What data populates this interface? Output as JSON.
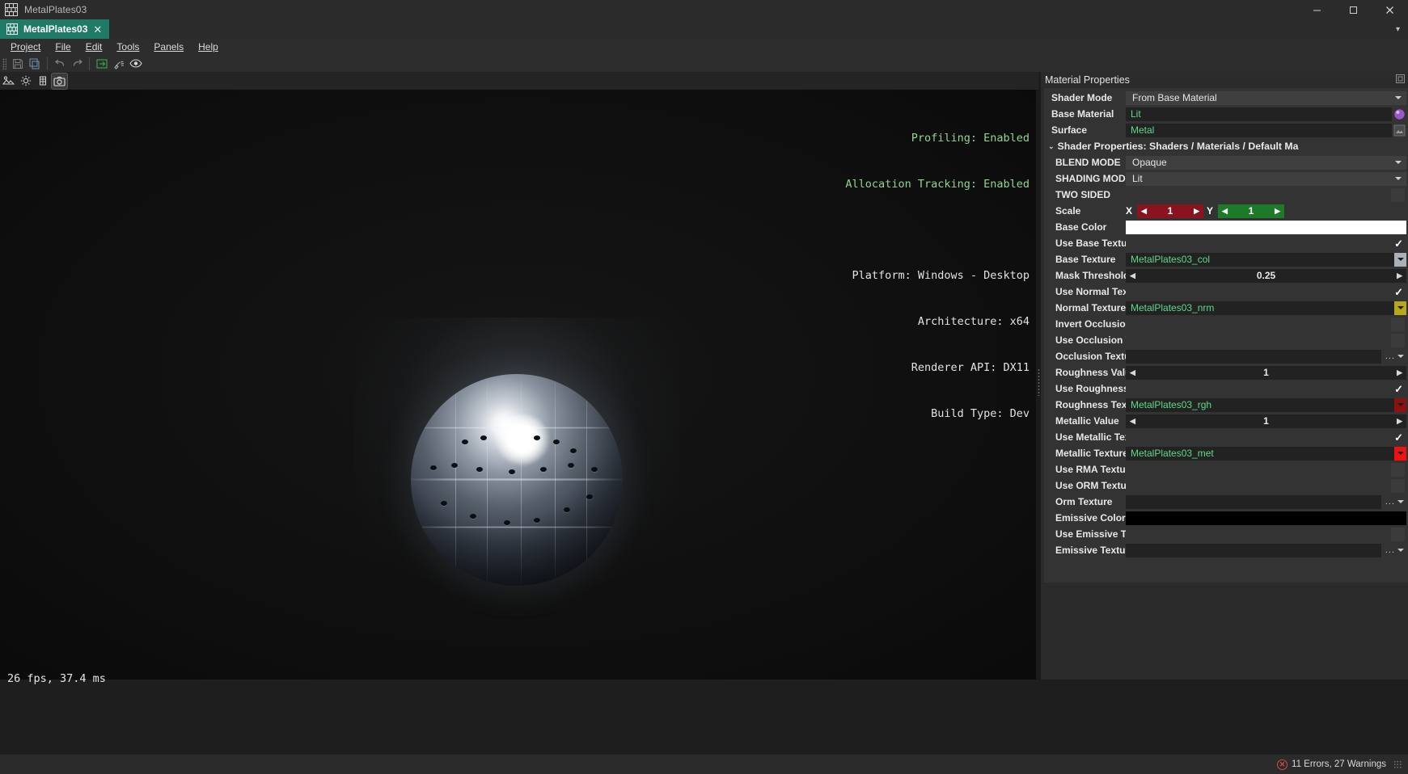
{
  "window": {
    "title": "MetalPlates03",
    "app_icon": "brick-wall-icon",
    "minimize": "—",
    "maximize": "□",
    "close": "✕"
  },
  "tabs": {
    "items": [
      {
        "label": "MetalPlates03",
        "icon": "brick-wall-icon",
        "close": "✕",
        "active": true
      }
    ],
    "overflow_chevron": "▾"
  },
  "menubar": {
    "items": [
      {
        "label": "Project"
      },
      {
        "label": "File"
      },
      {
        "label": "Edit"
      },
      {
        "label": "Tools"
      },
      {
        "label": "Panels"
      },
      {
        "label": "Help"
      }
    ]
  },
  "toolbar": {
    "buttons": [
      {
        "name": "save-icon"
      },
      {
        "name": "save-all-icon"
      },
      {
        "name": "undo-icon"
      },
      {
        "name": "redo-icon"
      },
      {
        "name": "export-icon"
      },
      {
        "name": "clean-icon"
      },
      {
        "name": "preview-eye-icon"
      }
    ]
  },
  "view_toolbar": {
    "buttons": [
      {
        "name": "asset-preview-icon"
      },
      {
        "name": "lighting-icon"
      },
      {
        "name": "grid-icon"
      },
      {
        "name": "camera-icon",
        "active": true
      }
    ]
  },
  "viewport": {
    "overlay": {
      "line1": "Profiling: Enabled",
      "line2": "Allocation Tracking: Enabled",
      "line3": "Platform: Windows - Desktop",
      "line4": "Architecture: x64",
      "line5": "Renderer API: DX11",
      "line6": "Build Type: Dev"
    },
    "fps": "26 fps, 37.4 ms",
    "preview_object": "metal-plates-sphere"
  },
  "properties": {
    "panel_title": "Material Properties",
    "dock_icon": "dock-panel-icon",
    "rows": [
      {
        "label": "Shader Mode",
        "type": "dropdown",
        "value": "From Base Material"
      },
      {
        "label": "Base Material",
        "type": "asset",
        "value": "Lit",
        "swatch": "sphere-asset-icon"
      },
      {
        "label": "Surface",
        "type": "asset",
        "value": "Metal",
        "swatch": "surface-asset-icon"
      },
      {
        "label": "Shader Properties: Shaders / Materials / Default Ma",
        "type": "section",
        "chevron": "⌄"
      },
      {
        "label": "BLEND MODE",
        "type": "dropdown",
        "value": "Opaque"
      },
      {
        "label": "SHADING MODE",
        "type": "dropdown",
        "value": "Lit"
      },
      {
        "label": "TWO SIDED",
        "type": "checkbox",
        "checked": false
      },
      {
        "label": "Scale",
        "type": "vector2",
        "x_axis": "X",
        "x_value": "1",
        "y_axis": "Y",
        "y_value": "1"
      },
      {
        "label": "Base Color",
        "type": "color",
        "value": "#ffffff"
      },
      {
        "label": "Use Base Texture",
        "type": "checkbox",
        "checked": true
      },
      {
        "label": "Base Texture",
        "type": "texture",
        "value": "MetalPlates03_col",
        "caret_color": "#a9b0b8"
      },
      {
        "label": "Mask Threshold",
        "type": "slider",
        "value": "0.25"
      },
      {
        "label": "Use Normal Texture",
        "type": "checkbox",
        "checked": true
      },
      {
        "label": "Normal Texture",
        "type": "texture",
        "value": "MetalPlates03_nrm",
        "caret_color": "#b5a81a"
      },
      {
        "label": "Invert Occlusion",
        "type": "checkbox",
        "checked": false
      },
      {
        "label": "Use Occlusion Texture",
        "type": "checkbox",
        "checked": false
      },
      {
        "label": "Occlusion Texture",
        "type": "path",
        "value": "",
        "dots": "..."
      },
      {
        "label": "Roughness Value",
        "type": "slider",
        "value": "1"
      },
      {
        "label": "Use Roughness",
        "type": "checkbox",
        "checked": true
      },
      {
        "label": "Roughness Texture",
        "type": "texture",
        "value": "MetalPlates03_rgh",
        "caret_color": "#8c1111"
      },
      {
        "label": "Metallic Value",
        "type": "slider",
        "value": "1"
      },
      {
        "label": "Use Metallic Texture",
        "type": "checkbox",
        "checked": true
      },
      {
        "label": "Metallic Texture",
        "type": "texture",
        "value": "MetalPlates03_met",
        "caret_color": "#f01010"
      },
      {
        "label": "Use RMA Texture",
        "type": "checkbox",
        "checked": false
      },
      {
        "label": "Use ORM Texture",
        "type": "checkbox",
        "checked": false
      },
      {
        "label": "Orm Texture",
        "type": "path",
        "value": "",
        "dots": "..."
      },
      {
        "label": "Emissive Color",
        "type": "color",
        "value": "#000000"
      },
      {
        "label": "Use Emissive Texture",
        "type": "checkbox",
        "checked": false
      },
      {
        "label": "Emissive Texture",
        "type": "path",
        "value": "",
        "dots": "..."
      }
    ]
  },
  "statusbar": {
    "error_icon": "error-circle-icon",
    "message": "11 Errors, 27 Warnings",
    "resize_grip": "resize-grip-icon"
  },
  "colors": {
    "tab_active": "#1f7a68",
    "asset_text": "#5fd98a",
    "error": "#d14b4b",
    "axis_x": "#8a1320",
    "axis_y": "#1d7a28"
  }
}
